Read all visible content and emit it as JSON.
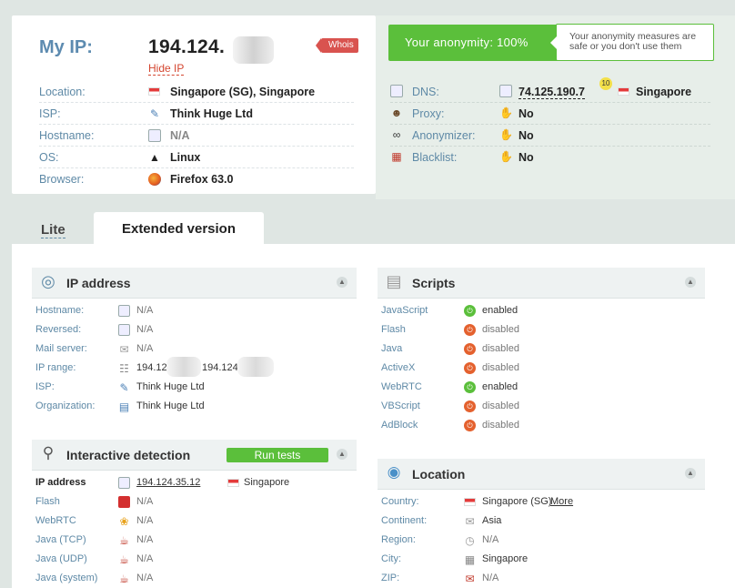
{
  "summary": {
    "my_ip_label": "My IP:",
    "my_ip_value": "194.124.",
    "hide_ip": "Hide IP",
    "whois": "Whois",
    "rows": [
      {
        "label": "Location:",
        "value": "Singapore (SG), Singapore",
        "icon": "sg-flag-icon"
      },
      {
        "label": "ISP:",
        "value": "Think Huge Ltd",
        "icon": "isp-icon"
      },
      {
        "label": "Hostname:",
        "value": "N/A",
        "icon": "computer-icon"
      },
      {
        "label": "OS:",
        "value": "Linux",
        "icon": "linux-icon"
      },
      {
        "label": "Browser:",
        "value": "Firefox 63.0",
        "icon": "firefox-icon"
      }
    ]
  },
  "anonymity": {
    "bar_text": "Your anonymity: 100%",
    "note": "Your anonymity measures are safe or you don't use them",
    "rows": [
      {
        "label": "DNS:",
        "value": "74.125.190.7",
        "badge": "10",
        "country": "Singapore"
      },
      {
        "label": "Proxy:",
        "value": "No"
      },
      {
        "label": "Anonymizer:",
        "value": "No"
      },
      {
        "label": "Blacklist:",
        "value": "No"
      }
    ]
  },
  "tabs": {
    "lite": "Lite",
    "extended": "Extended version"
  },
  "ip_section": {
    "title": "IP address",
    "rows": [
      {
        "label": "Hostname:",
        "value": "N/A"
      },
      {
        "label": "Reversed:",
        "value": "N/A"
      },
      {
        "label": "Mail server:",
        "value": "N/A"
      },
      {
        "label": "IP range:",
        "value_start": "194.124",
        "value_end": "194.124."
      },
      {
        "label": "ISP:",
        "value": "Think Huge Ltd"
      },
      {
        "label": "Organization:",
        "value": "Think Huge Ltd"
      }
    ]
  },
  "scripts_section": {
    "title": "Scripts",
    "rows": [
      {
        "label": "JavaScript",
        "value": "enabled",
        "status": "enabled"
      },
      {
        "label": "Flash",
        "value": "disabled",
        "status": "disabled"
      },
      {
        "label": "Java",
        "value": "disabled",
        "status": "disabled"
      },
      {
        "label": "ActiveX",
        "value": "disabled",
        "status": "disabled"
      },
      {
        "label": "WebRTC",
        "value": "enabled",
        "status": "enabled"
      },
      {
        "label": "VBScript",
        "value": "disabled",
        "status": "disabled"
      },
      {
        "label": "AdBlock",
        "value": "disabled",
        "status": "disabled"
      }
    ]
  },
  "interactive_section": {
    "title": "Interactive detection",
    "run_button": "Run tests",
    "rows": [
      {
        "label": "IP address",
        "value": "194.124.35.12",
        "country": "Singapore"
      },
      {
        "label": "Flash",
        "value": "N/A"
      },
      {
        "label": "WebRTC",
        "value": "N/A"
      },
      {
        "label": "Java (TCP)",
        "value": "N/A"
      },
      {
        "label": "Java (UDP)",
        "value": "N/A"
      },
      {
        "label": "Java (system)",
        "value": "N/A"
      }
    ]
  },
  "location_section": {
    "title": "Location",
    "more_link": "More",
    "rows": [
      {
        "label": "Country:",
        "value": "Singapore (SG)"
      },
      {
        "label": "Continent:",
        "value": "Asia"
      },
      {
        "label": "Region:",
        "value": "N/A"
      },
      {
        "label": "City:",
        "value": "Singapore"
      },
      {
        "label": "ZIP:",
        "value": "N/A"
      }
    ]
  },
  "colors": {
    "accent_green": "#5bbf3b",
    "label_blue": "#5e89a6",
    "hide_red": "#d4452f",
    "disabled_orange": "#e4612e"
  }
}
